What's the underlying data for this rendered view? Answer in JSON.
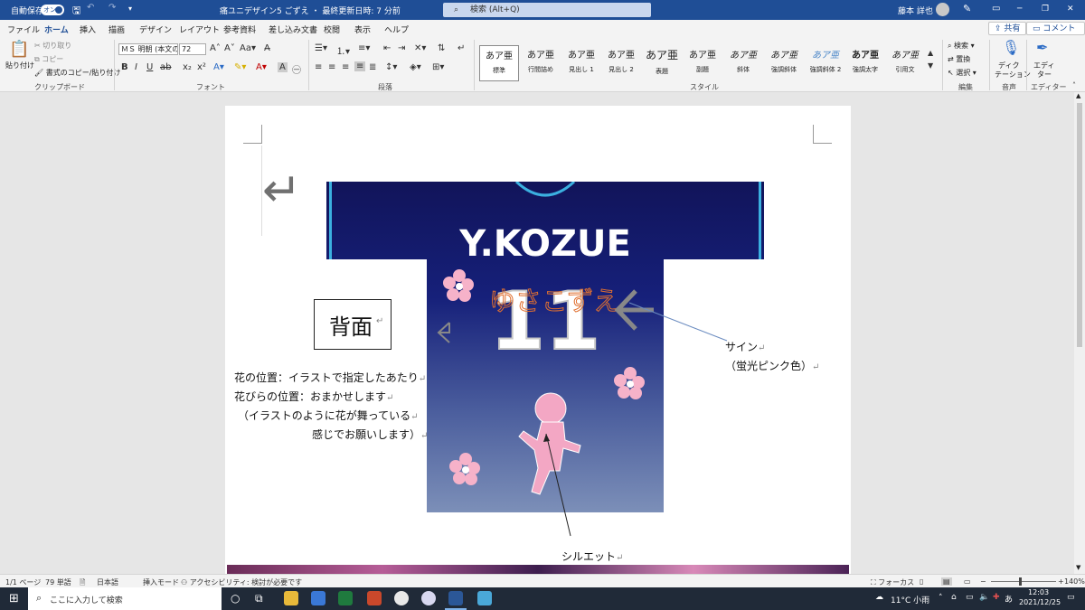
{
  "titlebar": {
    "autosave": "自動保存",
    "toggle": "オン",
    "doc_title": "痛ユニデザイン5 ごずえ ・ 最終更新日時: 7 分前",
    "search": "検索 (Alt+Q)",
    "user": "藤本 詳也"
  },
  "tabs": [
    "ファイル",
    "ホーム",
    "挿入",
    "描画",
    "デザイン",
    "レイアウト",
    "参考資料",
    "差し込み文書",
    "校閲",
    "表示",
    "ヘルプ"
  ],
  "share": {
    "share": "共有",
    "comment": "コメント"
  },
  "ribbon": {
    "clipboard": {
      "paste": "貼り付け",
      "cut": "切り取り",
      "copy": "コピー",
      "format_painter": "書式のコピー/貼り付け",
      "group": "クリップボード"
    },
    "font": {
      "name": "ＭＳ 明朝 (本文のフォン",
      "size": "72",
      "group": "フォント"
    },
    "paragraph": {
      "group": "段落"
    },
    "styles": {
      "group": "スタイル",
      "items": [
        {
          "preview": "あア亜",
          "name": "標準"
        },
        {
          "preview": "あア亜",
          "name": "行間詰め"
        },
        {
          "preview": "あア亜",
          "name": "見出し 1"
        },
        {
          "preview": "あア亜",
          "name": "見出し 2"
        },
        {
          "preview": "あア亜",
          "name": "表題"
        },
        {
          "preview": "あア亜",
          "name": "副題"
        },
        {
          "preview": "あア亜",
          "name": "斜体"
        },
        {
          "preview": "あア亜",
          "name": "強調斜体"
        },
        {
          "preview": "あア亜",
          "name": "強調斜体 2"
        },
        {
          "preview": "あア亜",
          "name": "強調太字"
        },
        {
          "preview": "あア亜",
          "name": "引用文"
        }
      ]
    },
    "editing": {
      "find": "検索",
      "replace": "置換",
      "select": "選択",
      "group": "編集"
    },
    "voice": {
      "dictate_1": "ディク",
      "dictate_2": "テーション",
      "group": "音声"
    },
    "editor": {
      "label_1": "エディ",
      "label_2": "ター",
      "group": "エディター"
    }
  },
  "document": {
    "back_label": "背面",
    "jersey_name": "Y.KOZUE",
    "jersey_number": "11",
    "signature": "ゆさこずえ",
    "sign_note_1": "サイン",
    "sign_note_2": "（蛍光ピンク色）",
    "flower_note_1": "花の位置：イラストで指定したあたり",
    "flower_note_2": "花びらの位置：おまかせします",
    "flower_note_3": "（イラストのように花が舞っている",
    "flower_note_4": "感じでお願いします）",
    "silhouette_note": "シルエット"
  },
  "status": {
    "page": "1/1 ページ",
    "words": "79 単語",
    "language": "日本語",
    "mode": "挿入モード",
    "accessibility": "アクセシビリティ: 検討が必要です",
    "focus": "フォーカス",
    "zoom": "140%"
  },
  "taskbar": {
    "search": "ここに入力して検索",
    "weather": "11°C 小雨",
    "ime": "あ",
    "time": "12:03",
    "date": "2021/12/25"
  }
}
